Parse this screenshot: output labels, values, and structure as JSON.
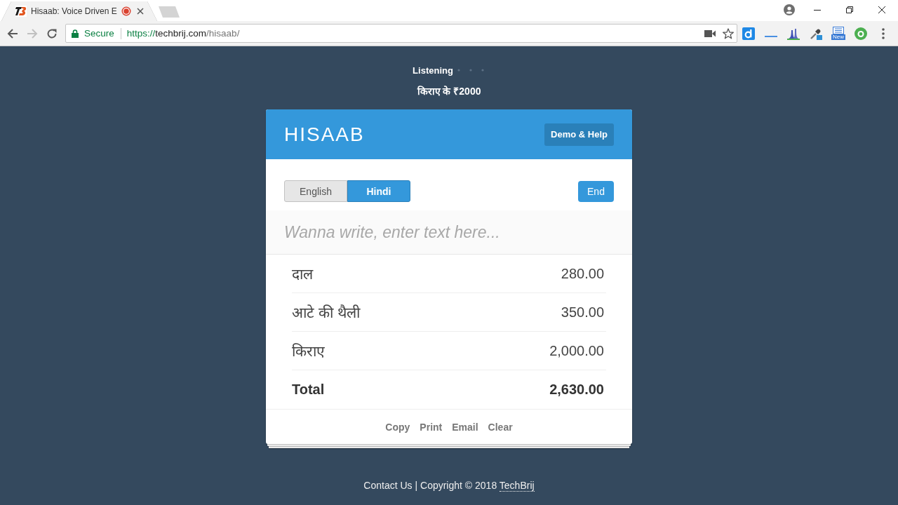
{
  "browser": {
    "tab": {
      "title": "Hisaab: Voice Driven E",
      "recording": true
    },
    "back": {
      "disabled": false
    },
    "forward": {
      "disabled": true
    },
    "address": {
      "secure_label": "Secure",
      "scheme": "https://",
      "host": "techbrij.com",
      "path": "/hisaab/"
    },
    "extension_badge": "New"
  },
  "status": {
    "label": "Listening",
    "transcript": "किराए के ₹2000"
  },
  "app": {
    "title": "HISAAB",
    "help_button": "Demo & Help",
    "languages": [
      {
        "label": "English",
        "selected": false
      },
      {
        "label": "Hindi",
        "selected": true
      }
    ],
    "end_button": "End",
    "entry": {
      "placeholder": "Wanna write, enter text here..."
    },
    "items": [
      {
        "name": "दाल",
        "amount": "280.00"
      },
      {
        "name": "आटे की थैली",
        "amount": "350.00"
      },
      {
        "name": "किराए",
        "amount": "2,000.00"
      }
    ],
    "total": {
      "label": "Total",
      "amount": "2,630.00"
    },
    "actions": [
      "Copy",
      "Print",
      "Email",
      "Clear"
    ]
  },
  "footer": {
    "contact_link": "Contact Us",
    "copyright": "| Copyright © 2018",
    "author_link": "TechBrij"
  }
}
